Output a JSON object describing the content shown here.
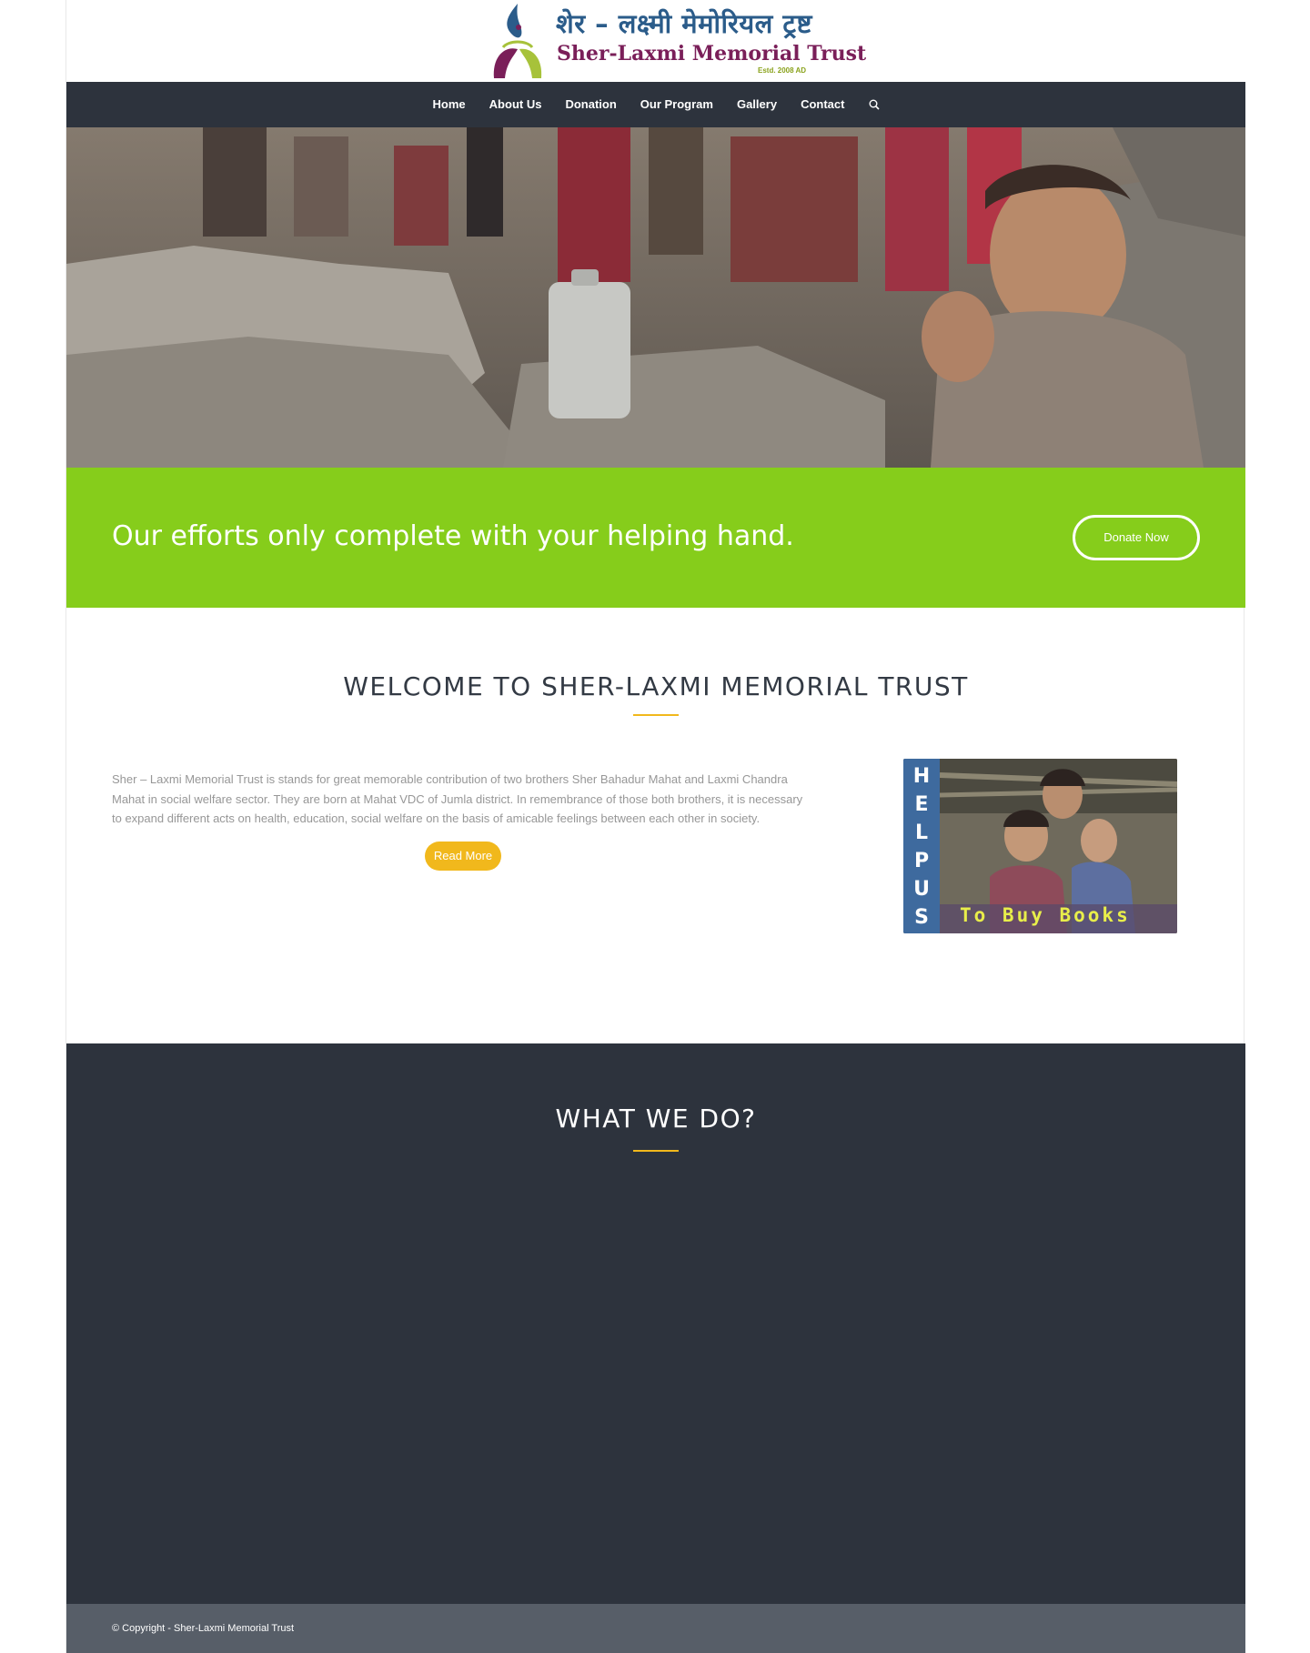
{
  "brand": {
    "name_devanagari": "शेर – लक्ष्मी मेमोरियल ट्रष्ट",
    "name_latin": "Sher-Laxmi Memorial Trust",
    "established": "Estd. 2008 AD",
    "logo_icon": "trust-logo-icon"
  },
  "nav": {
    "items": [
      "Home",
      "About Us",
      "Donation",
      "Our Program",
      "Gallery",
      "Contact"
    ],
    "search_icon": "search-icon"
  },
  "banner": {
    "message": "Our efforts only complete with your helping hand.",
    "button_label": "Donate Now"
  },
  "welcome": {
    "title": "WELCOME TO SHER-LAXMI MEMORIAL TRUST",
    "body": "Sher – Laxmi Memorial Trust is stands for great memorable contribution of two brothers Sher Bahadur Mahat and Laxmi Chandra Mahat in social welfare sector. They are born at Mahat VDC of Jumla district. In remembrance of those both brothers, it is necessary to expand different acts on health, education, social welfare on the basis of amicable feelings between each other in society.",
    "read_more": "Read More",
    "helpus": {
      "letters": [
        "H",
        "E",
        "L",
        "P",
        "U",
        "S"
      ],
      "caption": "To Buy Books"
    }
  },
  "what_we_do": {
    "title": "WHAT WE DO?"
  },
  "footer": {
    "copyright": "© Copyright - Sher-Laxmi Memorial Trust"
  },
  "colors": {
    "accent_green": "#86cd1b",
    "accent_gold": "#f1b81c",
    "dark": "#2d333d",
    "footer": "#575e68"
  }
}
